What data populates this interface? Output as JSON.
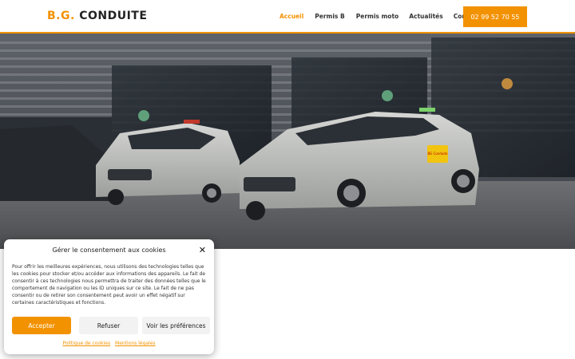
{
  "header": {
    "logo_prefix": "B.G.",
    "logo_main": "CONDUITE",
    "nav": [
      {
        "label": "Accueil",
        "active": true
      },
      {
        "label": "Permis B",
        "active": false
      },
      {
        "label": "Permis moto",
        "active": false
      },
      {
        "label": "Actualités",
        "active": false
      },
      {
        "label": "Contact",
        "active": false
      }
    ],
    "phone": "02 99 52 70 55"
  },
  "hero": {
    "image_text": "BG Conduite"
  },
  "cookie_banner": {
    "title": "Gérer le consentement aux cookies",
    "body": "Pour offrir les meilleures expériences, nous utilisons des technologies telles que les cookies pour stocker et/ou accéder aux informations des appareils. Le fait de consentir à ces technologies nous permettra de traiter des données telles que le comportement de navigation ou les ID uniques sur ce site. Le fait de ne pas consentir ou de retirer son consentement peut avoir un effet négatif sur certaines caractéristiques et fonctions.",
    "accept_label": "Accepter",
    "refuse_label": "Refuser",
    "prefs_label": "Voir les préférences",
    "cookie_policy_link": "Politique de cookies",
    "legal_link": "Mentions légales"
  },
  "colors": {
    "accent": "#f39200"
  }
}
